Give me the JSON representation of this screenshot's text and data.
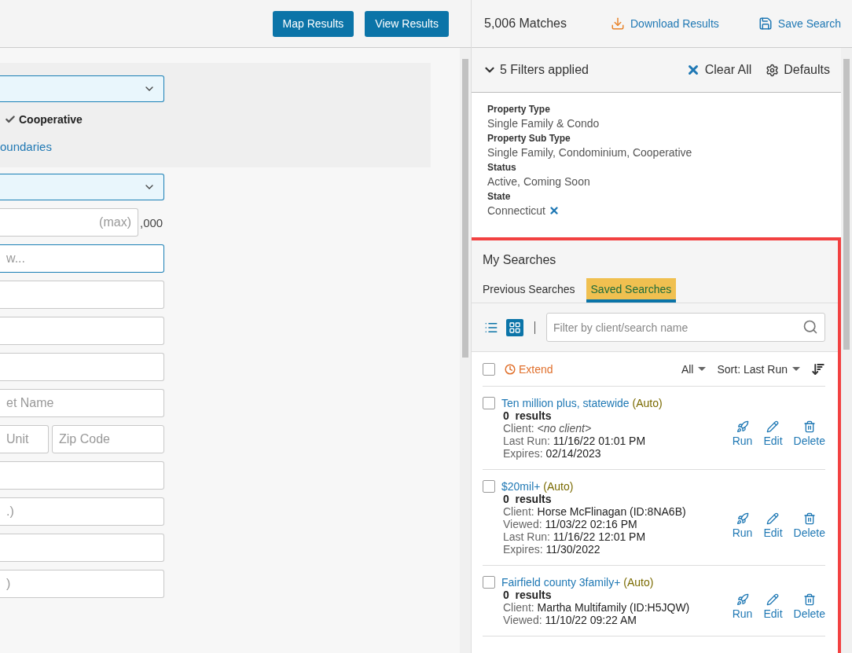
{
  "header": {
    "buttons": [
      "Map Results",
      "View Results"
    ]
  },
  "form": {
    "group": [
      {
        "kind": "select"
      },
      {
        "kind": "checkbox",
        "label": "Cooperative",
        "checked": true
      },
      {
        "kind": "link",
        "label": "oundaries"
      }
    ],
    "rows": [
      {
        "kind": "select"
      },
      {
        "kind": "suffix",
        "placeholder": "(max)",
        "suffix": ",000"
      },
      {
        "kind": "input",
        "placeholder": "w...",
        "focused": true
      },
      {
        "kind": "input",
        "focused": false
      },
      {
        "kind": "input",
        "focused": false
      },
      {
        "kind": "input",
        "focused": false
      },
      {
        "kind": "input",
        "placeholder": "et Name",
        "focused": false
      },
      {
        "kind": "pair",
        "placeholders": [
          "Unit",
          "Zip Code"
        ]
      },
      {
        "kind": "input",
        "focused": false
      },
      {
        "kind": "input",
        "placeholder": ".)",
        "focused": false
      },
      {
        "kind": "input",
        "focused": false
      },
      {
        "kind": "input",
        "placeholder": ")",
        "focused": false
      }
    ]
  },
  "results": {
    "matches": "5,006 Matches",
    "actions": [
      {
        "kind": "download",
        "label": "Download Results"
      },
      {
        "kind": "save",
        "label": "Save Search"
      }
    ]
  },
  "filters": {
    "summary": "5 Filters applied",
    "expanded": true,
    "actions": [
      {
        "kind": "clear",
        "label": "Clear All"
      },
      {
        "kind": "defaults",
        "label": "Defaults"
      }
    ],
    "items": [
      {
        "label": "Property Type",
        "value": "Single Family & Condo",
        "removable": false
      },
      {
        "label": "Property Sub Type",
        "value": "Single Family, Condominium, Cooperative",
        "removable": false
      },
      {
        "label": "Status",
        "value": "Active, Coming Soon",
        "removable": false
      },
      {
        "label": "State",
        "value": "Connecticut",
        "removable": true
      }
    ]
  },
  "my_searches": {
    "title": "My Searches",
    "tabs": [
      {
        "label": "Previous Searches",
        "selected": false
      },
      {
        "label": "Saved Searches",
        "selected": true
      }
    ],
    "views": [
      {
        "kind": "list",
        "selected": false
      },
      {
        "kind": "grid",
        "selected": true
      }
    ],
    "filter": {
      "placeholder": "Filter by client/search name"
    },
    "toolbar": {
      "select_all": false,
      "extend": "Extend",
      "scope": "All",
      "sort_label": "Sort:",
      "sort_value": "Last Run"
    },
    "searches": [
      {
        "name": "Ten million plus, statewide",
        "tag": "(Auto)",
        "results": "0  results",
        "checked": false,
        "lines": [
          {
            "label": "Client:",
            "value": "<no client>",
            "italic": true
          },
          {
            "label": "Last Run:",
            "value": "11/16/22 01:01 PM",
            "italic": false
          },
          {
            "label": "Expires:",
            "value": "02/14/2023",
            "italic": false
          }
        ],
        "actions": [
          {
            "kind": "run",
            "label": "Run"
          },
          {
            "kind": "edit",
            "label": "Edit"
          },
          {
            "kind": "delete",
            "label": "Delete"
          }
        ]
      },
      {
        "name": "$20mil+",
        "tag": "(Auto)",
        "results": "0  results",
        "checked": false,
        "lines": [
          {
            "label": "Client:",
            "value": "Horse McFlinagan (ID:8NA6B)",
            "italic": false
          },
          {
            "label": "Viewed:",
            "value": "11/03/22 02:16 PM",
            "italic": false
          },
          {
            "label": "Last Run:",
            "value": "11/16/22 12:01 PM",
            "italic": false
          },
          {
            "label": "Expires:",
            "value": "11/30/2022",
            "italic": false
          }
        ],
        "actions": [
          {
            "kind": "run",
            "label": "Run"
          },
          {
            "kind": "edit",
            "label": "Edit"
          },
          {
            "kind": "delete",
            "label": "Delete"
          }
        ]
      },
      {
        "name": "Fairfield county 3family+",
        "tag": "(Auto)",
        "results": "0  results",
        "checked": false,
        "lines": [
          {
            "label": "Client:",
            "value": "Martha Multifamily (ID:H5JQW)",
            "italic": false
          },
          {
            "label": "Viewed:",
            "value": "11/10/22 09:22 AM",
            "italic": false
          }
        ],
        "actions": [
          {
            "kind": "run",
            "label": "Run"
          },
          {
            "kind": "edit",
            "label": "Edit"
          },
          {
            "kind": "delete",
            "label": "Delete"
          }
        ]
      }
    ]
  }
}
